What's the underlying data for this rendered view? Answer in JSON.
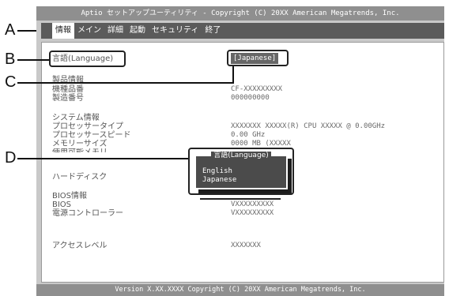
{
  "window": {
    "title": "Aptio セットアップユーティリティ - Copyright (C) 20XX American Megatrends, Inc.",
    "footer": "Version X.XX.XXXX Copyright (C) 20XX American Megatrends, Inc."
  },
  "menu": [
    {
      "label": "情報",
      "active": true
    },
    {
      "label": "メイン"
    },
    {
      "label": "詳細"
    },
    {
      "label": "起動"
    },
    {
      "label": "セキュリティ"
    },
    {
      "label": "終了"
    }
  ],
  "language": {
    "label": "言語(Language)",
    "value": "[Japanese]"
  },
  "product": {
    "heading": "製品情報",
    "model_label": "機種品番",
    "model_value": "CF-XXXXXXXXX",
    "serial_label": "製造番号",
    "serial_value": "000000000"
  },
  "system": {
    "heading": "システム情報",
    "cpu_type_label": "プロセッサータイプ",
    "cpu_type_value": "XXXXXXX XXXXX(R) CPU  XXXXX @ 0.00GHz",
    "cpu_speed_label": "プロセッサースピード",
    "cpu_speed_value": "0.00 GHz",
    "memory_label": "メモリーサイズ",
    "memory_value": "0000 MB (XXXXX",
    "usable_memory_label": "使用可能メモリ"
  },
  "hard_disk": {
    "label": "ハードディスク"
  },
  "bios": {
    "heading": "BIOS情報",
    "bios_label": "BIOS",
    "bios_value": "VXXXXXXXXX",
    "power_label": "電源コントローラー",
    "power_value": "VXXXXXXXXX"
  },
  "access": {
    "label": "アクセスレベル",
    "value": "XXXXXXX"
  },
  "popup": {
    "title": "言語(Language)",
    "options": [
      "English",
      "Japanese"
    ]
  },
  "callouts": {
    "a": "A",
    "b": "B",
    "c": "C",
    "d": "D"
  }
}
